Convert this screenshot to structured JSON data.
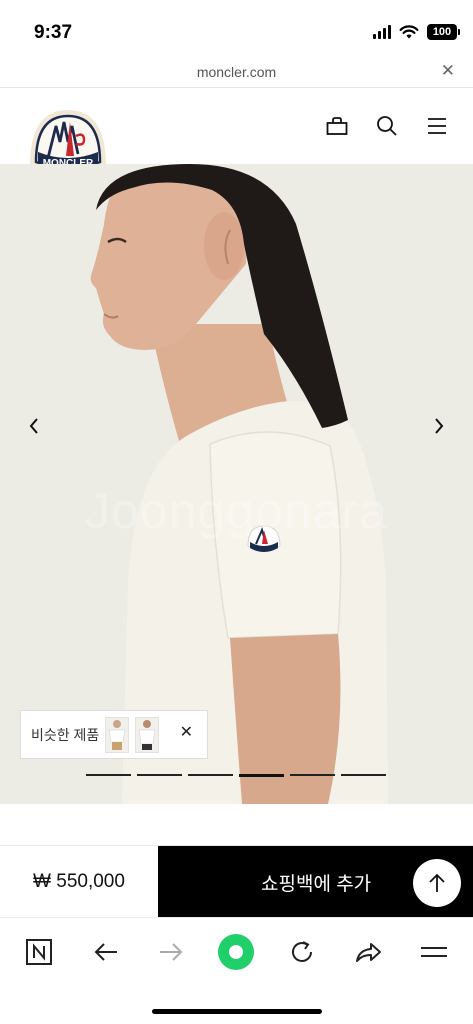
{
  "status": {
    "time": "9:37",
    "battery": "100"
  },
  "browser": {
    "url": "moncler.com"
  },
  "header": {
    "logo_text": "MONCLER"
  },
  "hero": {
    "watermark": "Joonggonara",
    "similar_label": "비슷한 제품",
    "carousel_total": 6,
    "carousel_active": 4
  },
  "buy": {
    "price": "₩ 550,000",
    "add_label": "쇼핑백에 추가"
  },
  "colors": {
    "brand_red": "#c8282d",
    "brand_navy": "#1d2b4f",
    "toolbar_green": "#1fcf6a"
  },
  "icons": [
    "signal-icon",
    "wifi-icon",
    "battery-icon",
    "close-icon",
    "shopping-bag-icon",
    "search-icon",
    "menu-icon",
    "chevron-left-icon",
    "chevron-right-icon",
    "arrow-up-icon",
    "naver-n-icon",
    "back-arrow-icon",
    "forward-arrow-icon",
    "green-dot-icon",
    "reload-icon",
    "share-icon",
    "hamburger-icon"
  ]
}
